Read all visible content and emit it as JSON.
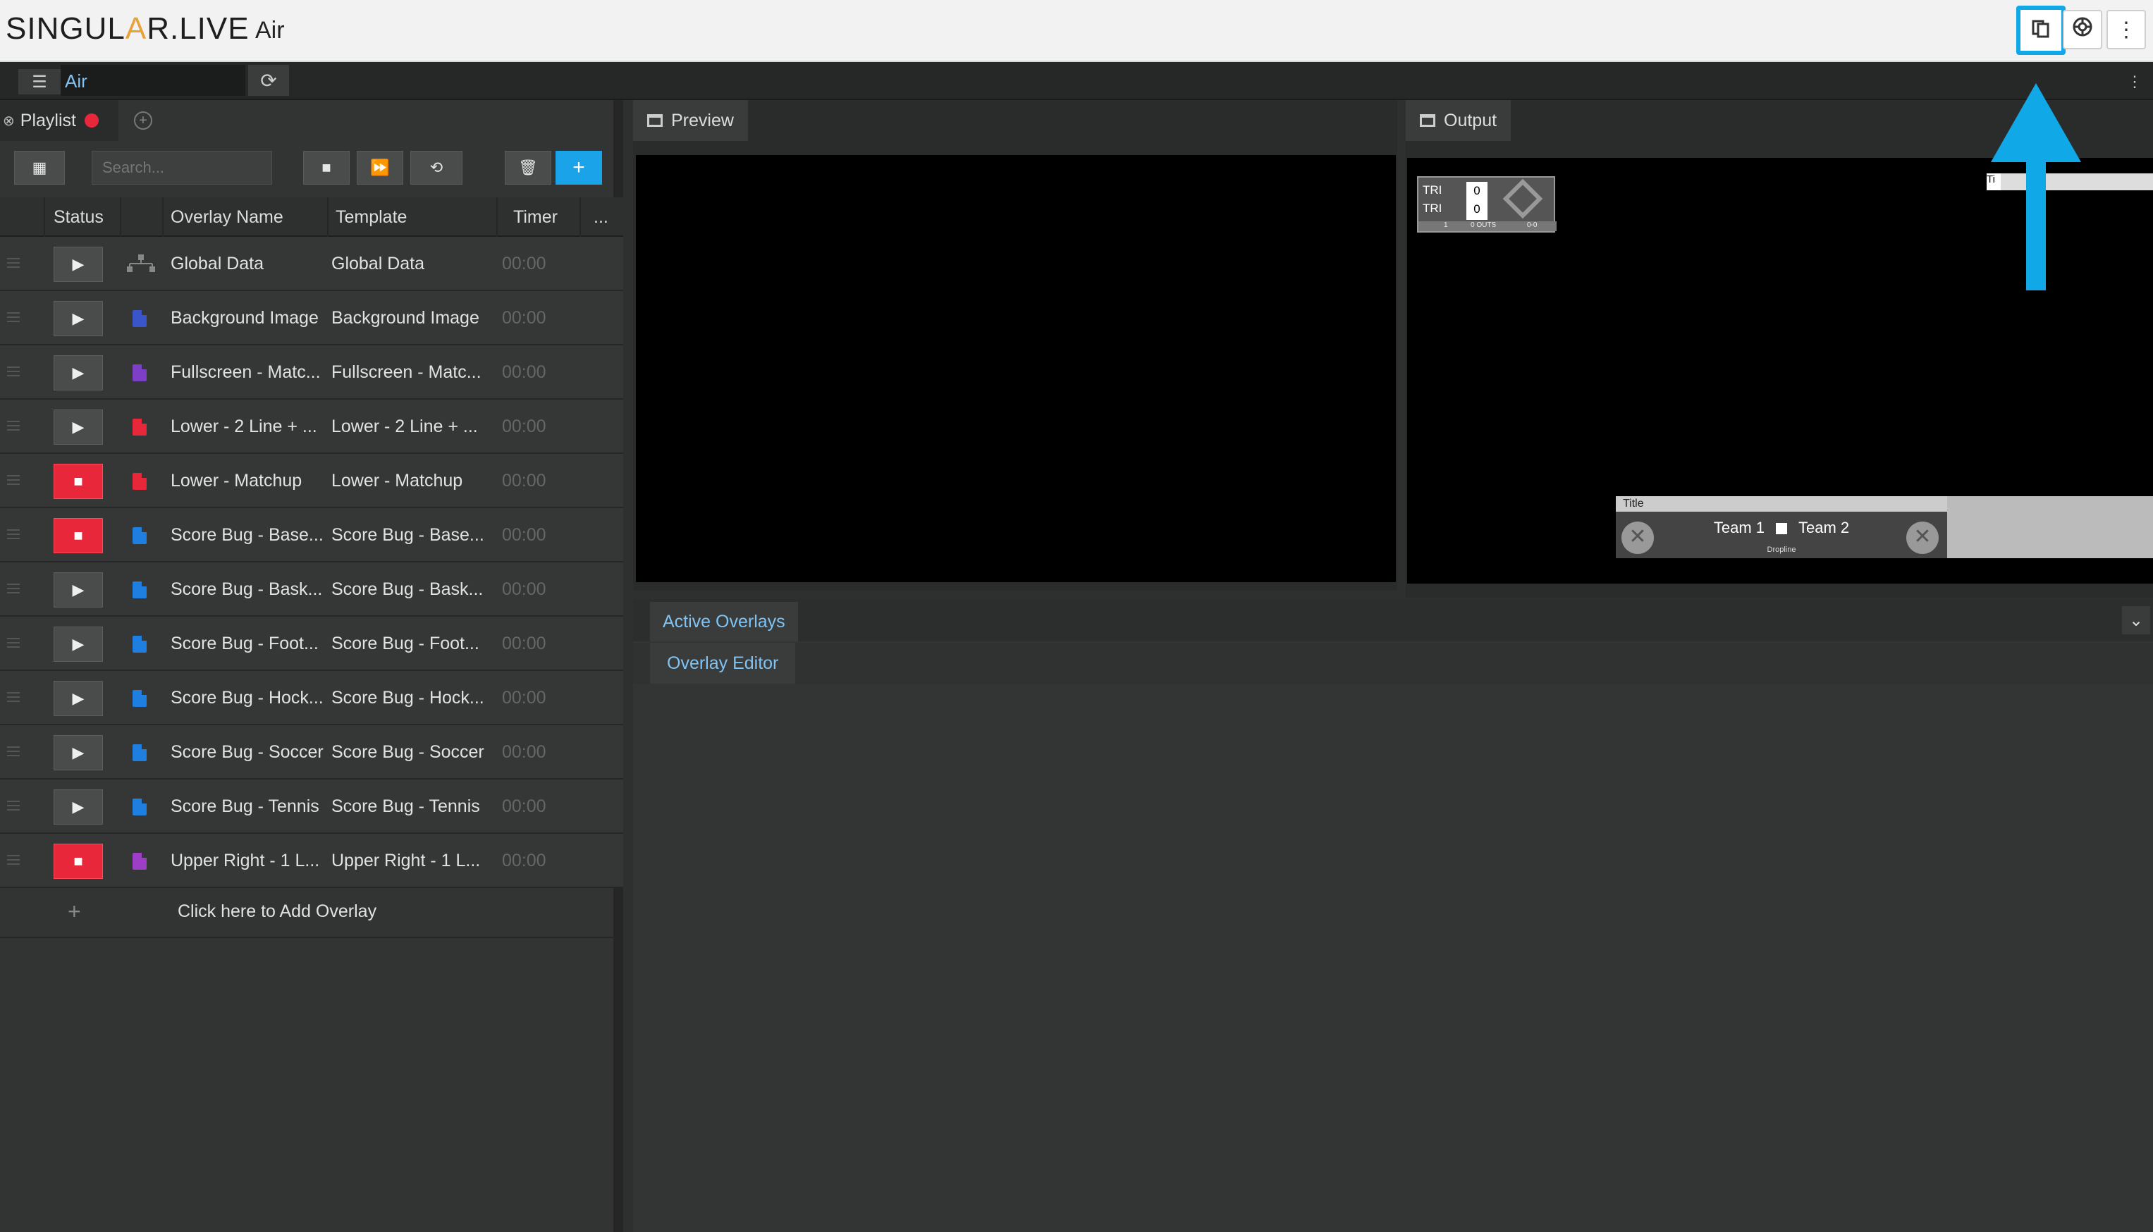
{
  "app": {
    "logo_prefix": "SINGUL",
    "logo_a": "A",
    "logo_suffix": "R.LIVE",
    "title": "Air"
  },
  "topbar": {
    "icons": [
      "documents-icon",
      "help-lifebuoy-icon",
      "more-vertical-icon"
    ],
    "highlight_color": "#11a8e8"
  },
  "workspace": {
    "name": "Air"
  },
  "playlist": {
    "tab_label": "Playlist",
    "search_placeholder": "Search...",
    "columns": {
      "status": "Status",
      "name": "Overlay Name",
      "template": "Template",
      "timer": "Timer",
      "more": "..."
    },
    "rows": [
      {
        "name": "Global Data",
        "template": "Global Data",
        "timer": "00:00",
        "active": false,
        "icon_color": "#777777"
      },
      {
        "name": "Background Image",
        "template": "Background Image",
        "timer": "00:00",
        "active": false,
        "icon_color": "#3a55c9"
      },
      {
        "name": "Fullscreen - Matc...",
        "template": "Fullscreen - Matc...",
        "timer": "00:00",
        "active": false,
        "icon_color": "#7c3fc6"
      },
      {
        "name": "Lower - 2 Line + ...",
        "template": "Lower - 2 Line + ...",
        "timer": "00:00",
        "active": false,
        "icon_color": "#e8283a"
      },
      {
        "name": "Lower - Matchup",
        "template": "Lower - Matchup",
        "timer": "00:00",
        "active": true,
        "icon_color": "#e8283a"
      },
      {
        "name": "Score Bug - Base...",
        "template": "Score Bug - Base...",
        "timer": "00:00",
        "active": true,
        "icon_color": "#1e7fe0"
      },
      {
        "name": "Score Bug - Bask...",
        "template": "Score Bug - Bask...",
        "timer": "00:00",
        "active": false,
        "icon_color": "#1e7fe0"
      },
      {
        "name": "Score Bug - Foot...",
        "template": "Score Bug - Foot...",
        "timer": "00:00",
        "active": false,
        "icon_color": "#1e7fe0"
      },
      {
        "name": "Score Bug - Hock...",
        "template": "Score Bug - Hock...",
        "timer": "00:00",
        "active": false,
        "icon_color": "#1e7fe0"
      },
      {
        "name": "Score Bug - Soccer",
        "template": "Score Bug - Soccer",
        "timer": "00:00",
        "active": false,
        "icon_color": "#1e7fe0"
      },
      {
        "name": "Score Bug - Tennis",
        "template": "Score Bug - Tennis",
        "timer": "00:00",
        "active": false,
        "icon_color": "#1e7fe0"
      },
      {
        "name": "Upper Right - 1 L...",
        "template": "Upper Right - 1 L...",
        "timer": "00:00",
        "active": true,
        "icon_color": "#9c3fc6"
      }
    ],
    "add_overlay": "Click here to Add Overlay"
  },
  "preview": {
    "tab_label": "Preview"
  },
  "output": {
    "tab_label": "Output",
    "scorebug": {
      "team_a": "TRI",
      "team_b": "TRI",
      "score_a": "0",
      "score_b": "0",
      "footer_1": "1",
      "footer_2": "0 OUTS",
      "footer_3": "0-0"
    },
    "upper_right": "Ti",
    "lower": {
      "title": "Title",
      "team1": "Team 1",
      "team2": "Team 2",
      "sub": "Dropline"
    }
  },
  "bottom": {
    "active_overlays_tab": "Active Overlays",
    "overlay_editor_tab": "Overlay Editor"
  }
}
